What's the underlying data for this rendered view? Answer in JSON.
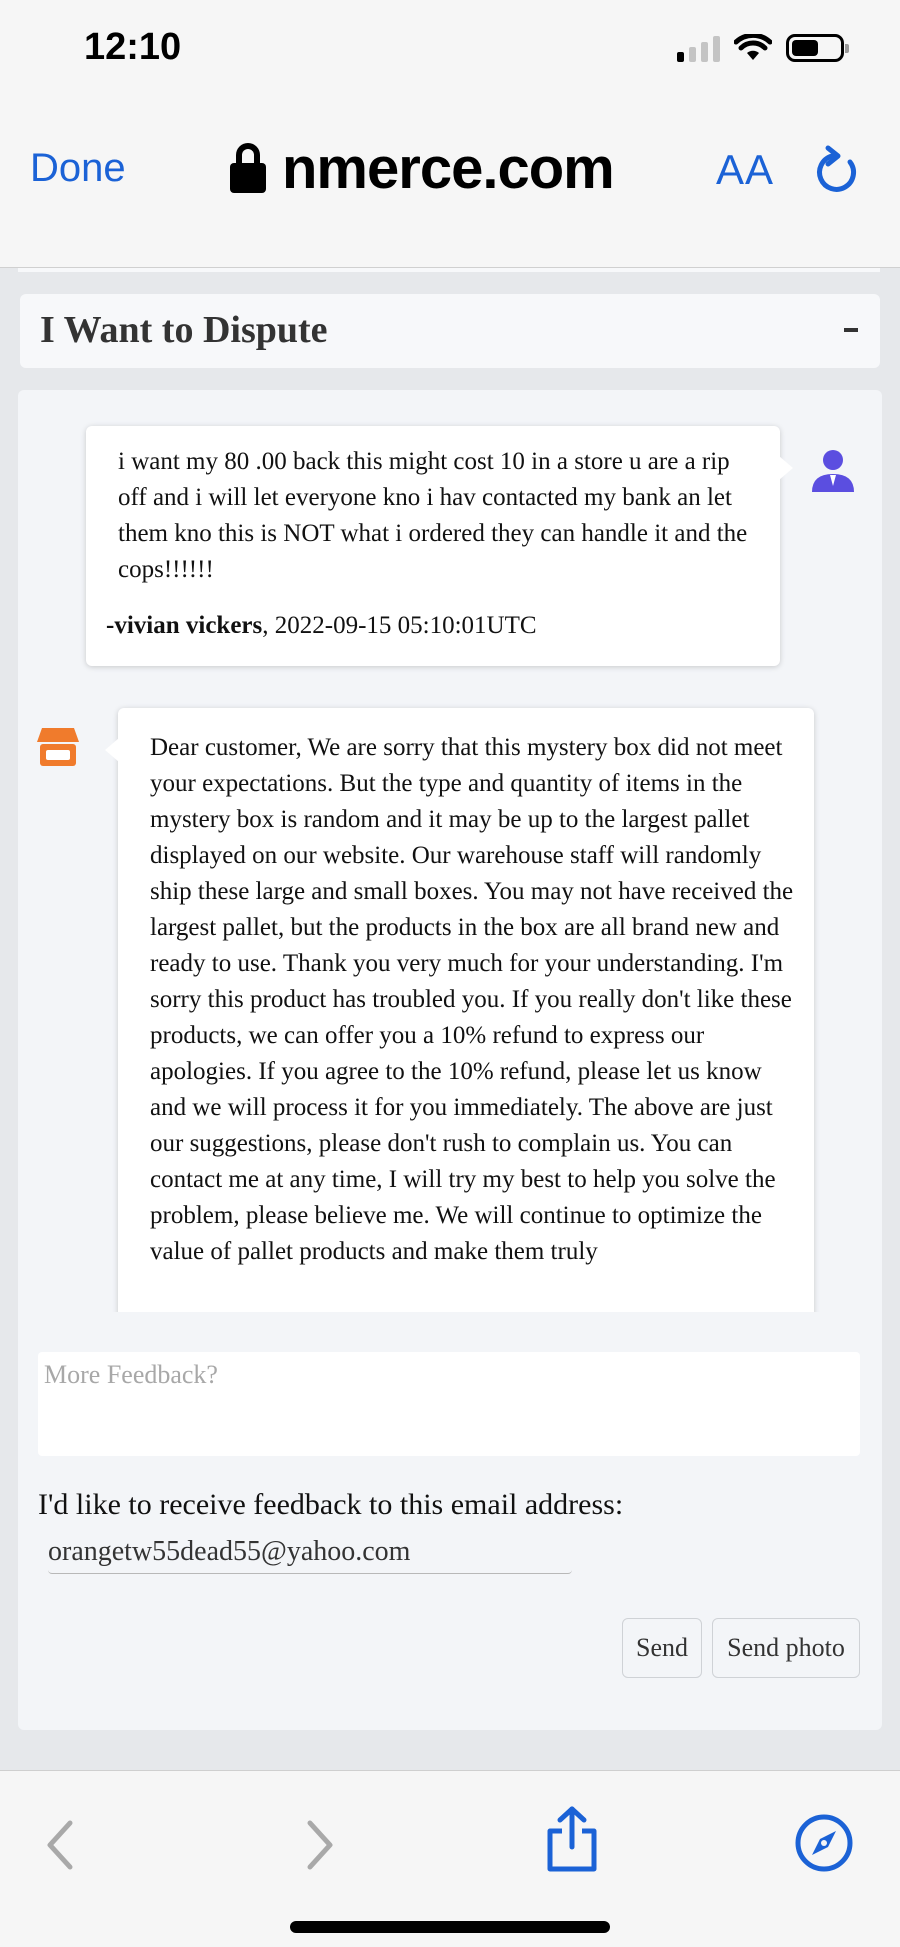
{
  "status_bar": {
    "time": "12:10"
  },
  "browser": {
    "done_label": "Done",
    "url": "nmerce.com",
    "text_size_label": "AA"
  },
  "dispute": {
    "title": "I Want to Dispute",
    "toggle": "-"
  },
  "messages": [
    {
      "text": "i want my 80 .00 back this might cost 10 in a store u are a rip off and i will let everyone kno i hav contacted my bank an let them kno this is NOT what i ordered they can handle it and the cops!!!!!!",
      "author": "-vivian vickers",
      "timestamp": ", 2022-09-15 05:10:01UTC"
    },
    {
      "text": "Dear customer, We are sorry that this mystery box did not meet your expectations. But the type and quantity of items in the mystery box is random and it may be up to the largest pallet displayed on our website. Our warehouse staff will randomly ship these large and small boxes. You may not have received the largest pallet, but the products in the box are all brand new and ready to use. Thank you very much for your understanding. I'm sorry this product has troubled you. If you really don't like these products, we can offer you a 10% refund to express our apologies. If you agree to the 10% refund, please let us know and we will process it for you immediately. The above are just our suggestions, please don't rush to complain us. You can contact me at any time, I will try my best to help you solve the problem, please believe me. We will continue to optimize the value of pallet products and make them truly"
    }
  ],
  "feedback": {
    "placeholder": "More Feedback?",
    "email_label": "I'd like to receive feedback to this email address:",
    "email_value": "orangetw55dead55@yahoo.com",
    "send_label": "Send",
    "send_photo_label": "Send photo"
  },
  "colors": {
    "accent_blue": "#1b62d6",
    "customer_avatar": "#5b4ee0",
    "store_icon": "#f07b2c"
  }
}
